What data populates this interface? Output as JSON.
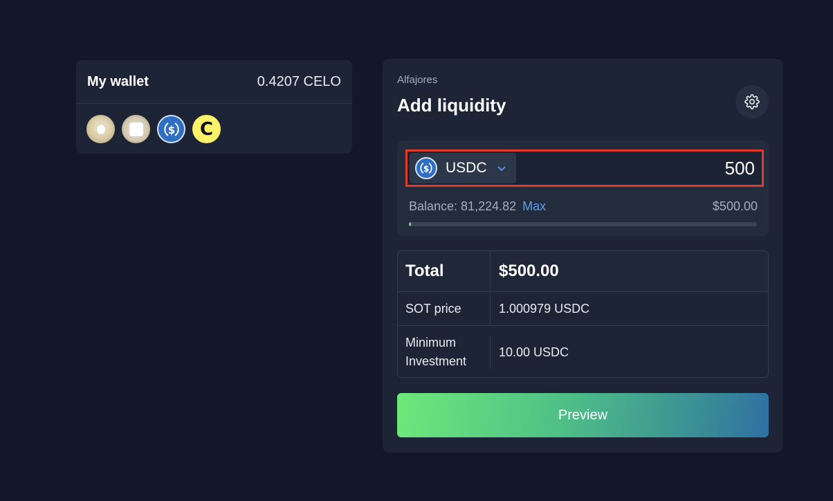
{
  "wallet": {
    "title": "My wallet",
    "balance": "0.4207 CELO",
    "tokens": [
      {
        "icon": "token-beige-drop-icon"
      },
      {
        "icon": "token-beige-square-icon"
      },
      {
        "icon": "usdc-icon"
      },
      {
        "icon": "c-token-icon",
        "letter": "C"
      }
    ]
  },
  "panel": {
    "network": "Alfajores",
    "title": "Add liquidity",
    "settings_icon": "gear-icon"
  },
  "input": {
    "token": "USDC",
    "amount": "500",
    "balance_label": "Balance: 81,224.82",
    "max_label": "Max",
    "usd_value": "$500.00",
    "progress_fraction": 0.006
  },
  "summary": {
    "total_label": "Total",
    "total_value": "$500.00",
    "price_label": "SOT price",
    "price_value": "1.000979 USDC",
    "min_label_line1": "Minimum",
    "min_label_line2": "Investment",
    "min_value": "10.00 USDC"
  },
  "preview_label": "Preview",
  "colors": {
    "background": "#12182a",
    "card": "#1c2435",
    "accent_blue": "#5b9cf0",
    "highlight_red": "#e23a2a",
    "progress_green": "#68e07b"
  }
}
